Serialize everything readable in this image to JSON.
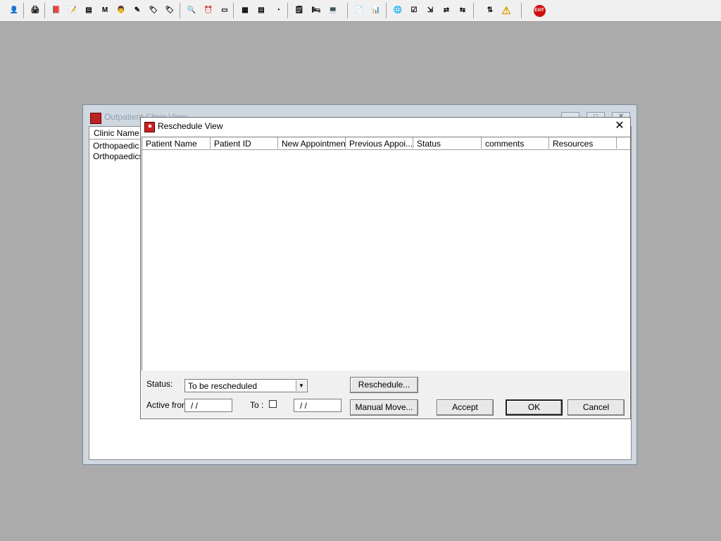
{
  "toolbar": {
    "buttons": [
      {
        "icon": "user-icon",
        "glyph": "👤"
      },
      {
        "icon": "printer-icon",
        "glyph": "🖨"
      },
      {
        "icon": "book-icon",
        "glyph": "📕"
      },
      {
        "icon": "notes-icon",
        "glyph": "📝"
      },
      {
        "icon": "list-icon",
        "glyph": "▤"
      },
      {
        "icon": "m-icon",
        "glyph": "M"
      },
      {
        "icon": "doctor-icon",
        "glyph": "👨"
      },
      {
        "icon": "edit-icon",
        "glyph": "✎"
      },
      {
        "icon": "tag-icon",
        "glyph": "🏷"
      },
      {
        "icon": "tag2-icon",
        "glyph": "🏷"
      },
      {
        "icon": "search-icon",
        "glyph": "🔍"
      },
      {
        "icon": "clock-icon",
        "glyph": "⏰"
      },
      {
        "icon": "monitor-icon",
        "glyph": "▭"
      },
      {
        "icon": "chart-icon",
        "glyph": "▦"
      },
      {
        "icon": "form-icon",
        "glyph": "▤"
      },
      {
        "icon": "gauge-icon",
        "glyph": "◔"
      },
      {
        "icon": "notepad-icon",
        "glyph": "🗒"
      },
      {
        "icon": "bed-icon",
        "glyph": "🛏"
      },
      {
        "icon": "person-pc-icon",
        "glyph": "💻"
      },
      {
        "icon": "document-icon",
        "glyph": "📄"
      },
      {
        "icon": "bars-icon",
        "glyph": "📊"
      },
      {
        "icon": "globe-icon",
        "glyph": "🌐"
      },
      {
        "icon": "form-check-icon",
        "glyph": "☑"
      },
      {
        "icon": "form-arrow-icon",
        "glyph": "⇲"
      },
      {
        "icon": "transfer-icon",
        "glyph": "⇄"
      },
      {
        "icon": "transfer2-icon",
        "glyph": "⇆"
      },
      {
        "icon": "swap-icon",
        "glyph": "⇅"
      },
      {
        "icon": "warning-icon",
        "glyph": "⚠"
      },
      {
        "icon": "exit-icon",
        "glyph": "EXIT"
      }
    ]
  },
  "outer_window": {
    "title": "Outpatient Clinic View",
    "column_header": "Clinic Name",
    "rows": [
      "Orthopaedic P",
      "Orthopaedics,"
    ]
  },
  "dialog": {
    "title": "Reschedule View",
    "columns": [
      "Patient Name",
      "Patient ID",
      "New Appointment",
      "Previous Appoi...",
      "Status",
      "comments",
      "Resources"
    ],
    "status_label": "Status:",
    "status_value": "To be rescheduled",
    "active_from_label": "Active from",
    "active_from_value": "/ /",
    "to_label": "To :",
    "to_value": "/ /",
    "buttons": {
      "reschedule": "Reschedule...",
      "manual_move": "Manual Move...",
      "accept": "Accept",
      "ok": "OK",
      "cancel": "Cancel"
    }
  },
  "colors": {
    "desktop": "#ababab",
    "exit": "#d01010"
  }
}
